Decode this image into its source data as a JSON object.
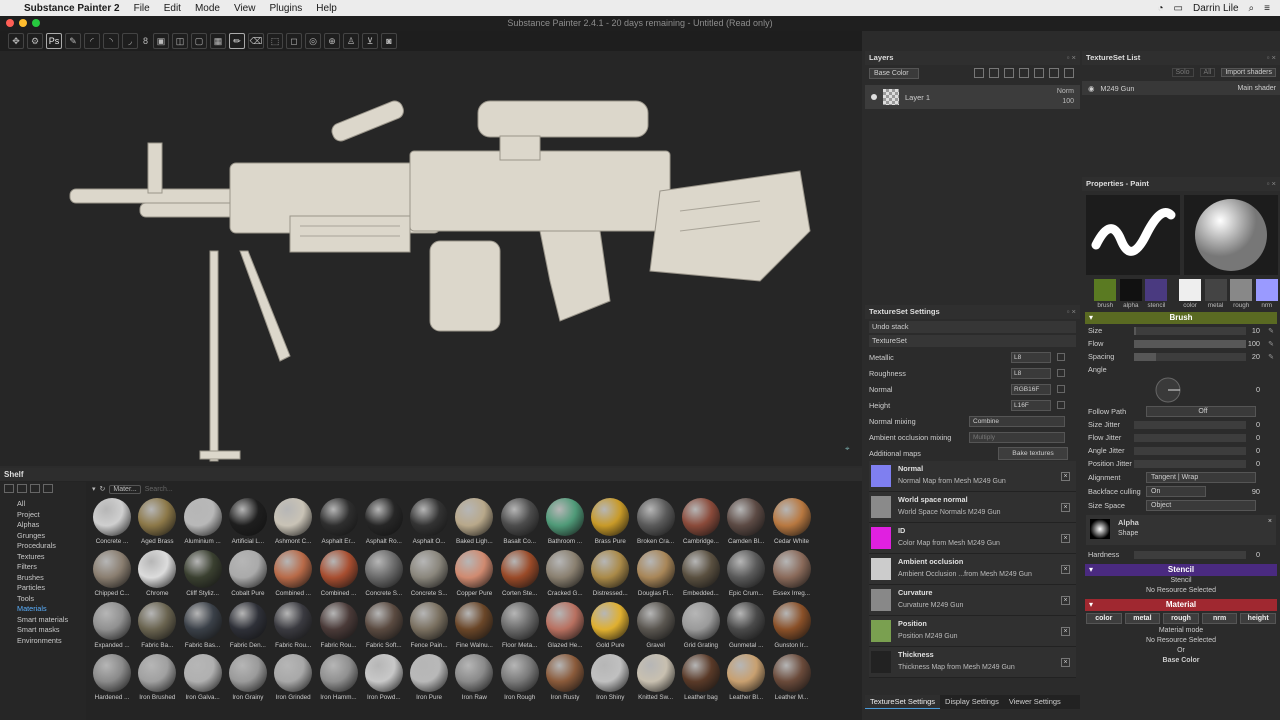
{
  "menubar": {
    "app": "Substance Painter 2",
    "menus": [
      "File",
      "Edit",
      "Mode",
      "View",
      "Plugins",
      "Help"
    ],
    "user": "Darrin Lile"
  },
  "window": {
    "title": "Substance Painter 2.4.1 - 20 days remaining - Untitled (Read only)"
  },
  "toolbar": {
    "brush_size": "8",
    "ps_label": "Ps"
  },
  "shelf": {
    "title": "Shelf",
    "categories": [
      "All",
      "Project",
      "Alphas",
      "Grunges",
      "Procedurals",
      "Textures",
      "Filters",
      "Brushes",
      "Particles",
      "Tools",
      "Materials",
      "Smart materials",
      "Smart masks",
      "Environments"
    ],
    "selected_category": "Materials",
    "filter_chip": "Mater...",
    "search_placeholder": "Search...",
    "items": [
      {
        "label": "Concrete ...",
        "color": "#cfcfcf"
      },
      {
        "label": "Aged Brass",
        "color": "#8c7848"
      },
      {
        "label": "Aluminium ...",
        "color": "#b8b8b8"
      },
      {
        "label": "Artificial L...",
        "color": "#1e1e1e"
      },
      {
        "label": "Ashmont C...",
        "color": "#c9c3b6"
      },
      {
        "label": "Asphalt Er...",
        "color": "#2e2e2e"
      },
      {
        "label": "Asphalt Ro...",
        "color": "#262626"
      },
      {
        "label": "Asphalt O...",
        "color": "#333333"
      },
      {
        "label": "Baked Ligh...",
        "color": "#b8a88a"
      },
      {
        "label": "Basalt Co...",
        "color": "#4c4c4c"
      },
      {
        "label": "Bathroom ...",
        "color": "#4f9a78"
      },
      {
        "label": "Brass Pure",
        "color": "#c89a28"
      },
      {
        "label": "Broken Cra...",
        "color": "#5a5a5a"
      },
      {
        "label": "Cambridge...",
        "color": "#8a4a3a"
      },
      {
        "label": "Camden Bl...",
        "color": "#5c4a44"
      },
      {
        "label": "Cedar White",
        "color": "#b87840"
      },
      {
        "label": "Chipped C...",
        "color": "#8a7e70"
      },
      {
        "label": "Chrome",
        "color": "#dcdcdc"
      },
      {
        "label": "Cliff Styliz...",
        "color": "#3a4030"
      },
      {
        "label": "Cobalt Pure",
        "color": "#aaaaaa"
      },
      {
        "label": "Combined ...",
        "color": "#b86a48"
      },
      {
        "label": "Combined ...",
        "color": "#a84e30"
      },
      {
        "label": "Concrete S...",
        "color": "#6a6a6a"
      },
      {
        "label": "Concrete S...",
        "color": "#8a867c"
      },
      {
        "label": "Copper Pure",
        "color": "#d08a70"
      },
      {
        "label": "Corten Ste...",
        "color": "#9a4a28"
      },
      {
        "label": "Cracked G...",
        "color": "#8a8070"
      },
      {
        "label": "Distressed...",
        "color": "#aa8a48"
      },
      {
        "label": "Douglas Fl...",
        "color": "#a88658"
      },
      {
        "label": "Embedded...",
        "color": "#5a5040"
      },
      {
        "label": "Epic Crum...",
        "color": "#5a5a5a"
      },
      {
        "label": "Essex Irreg...",
        "color": "#8a6a5a"
      },
      {
        "label": "Expanded ...",
        "color": "#909090"
      },
      {
        "label": "Fabric Ba...",
        "color": "#6a6450"
      },
      {
        "label": "Fabric Bas...",
        "color": "#3a4048"
      },
      {
        "label": "Fabric Den...",
        "color": "#2e3038"
      },
      {
        "label": "Fabric Rou...",
        "color": "#3a3a40"
      },
      {
        "label": "Fabric Rou...",
        "color": "#4a3a38"
      },
      {
        "label": "Fabric Soft...",
        "color": "#5a4a40"
      },
      {
        "label": "Fence Pain...",
        "color": "#7a7060"
      },
      {
        "label": "Fine Walnu...",
        "color": "#6a4628"
      },
      {
        "label": "Floor Meta...",
        "color": "#6a6a6a"
      },
      {
        "label": "Glazed He...",
        "color": "#b87060"
      },
      {
        "label": "Gold Pure",
        "color": "#e0b030"
      },
      {
        "label": "Gravel",
        "color": "#5a5650"
      },
      {
        "label": "Grid Grating",
        "color": "#9a9a9a"
      },
      {
        "label": "Gunmetal ...",
        "color": "#4a4a4a"
      },
      {
        "label": "Gunston Ir...",
        "color": "#8a5028"
      },
      {
        "label": "Hardened ...",
        "color": "#8a8a8a"
      },
      {
        "label": "Iron Brushed",
        "color": "#a0a0a0"
      },
      {
        "label": "Iron Galva...",
        "color": "#b0b0b0"
      },
      {
        "label": "Iron Grainy",
        "color": "#9a9a9a"
      },
      {
        "label": "Iron Grinded",
        "color": "#a8a8a8"
      },
      {
        "label": "Iron Hamm...",
        "color": "#909090"
      },
      {
        "label": "Iron Powd...",
        "color": "#c8c8c8"
      },
      {
        "label": "Iron Pure",
        "color": "#b8b8b8"
      },
      {
        "label": "Iron Raw",
        "color": "#8a8a8a"
      },
      {
        "label": "Iron Rough",
        "color": "#7a7a7a"
      },
      {
        "label": "Iron Rusty",
        "color": "#8a5a3a"
      },
      {
        "label": "Iron Shiny",
        "color": "#c0c0c0"
      },
      {
        "label": "Knitted Sw...",
        "color": "#c8c0b0"
      },
      {
        "label": "Leather bag",
        "color": "#5a3a28"
      },
      {
        "label": "Leather Bl...",
        "color": "#c8a070"
      },
      {
        "label": "Leather M...",
        "color": "#6a4a3a"
      }
    ]
  },
  "layers": {
    "title": "Layers",
    "channel": "Base Color",
    "layer": {
      "name": "Layer 1",
      "blend": "Norm",
      "opacity": "100"
    }
  },
  "tss": {
    "title": "TextureSet Settings",
    "undo": "Undo stack",
    "textureset": "TextureSet",
    "maps": [
      {
        "name": "Metallic",
        "fmt": "L8"
      },
      {
        "name": "Roughness",
        "fmt": "L8"
      },
      {
        "name": "Normal",
        "fmt": "RGB16F"
      },
      {
        "name": "Height",
        "fmt": "L16F"
      }
    ],
    "normal_mixing": "Normal mixing",
    "normal_mixing_val": "Combine",
    "ao_mixing": "Ambient occlusion mixing",
    "ao_mixing_val": "Multiply",
    "additional": "Additional maps",
    "bake": "Bake textures",
    "baked": [
      {
        "title": "Normal",
        "desc": "Normal Map from Mesh M249 Gun",
        "color": "#7f7ff0"
      },
      {
        "title": "World space normal",
        "desc": "World Space Normals M249 Gun",
        "color": "#8a8a8a"
      },
      {
        "title": "ID",
        "desc": "Color Map from Mesh M249 Gun",
        "color": "#e020e0"
      },
      {
        "title": "Ambient occlusion",
        "desc": "Ambient Occlusion ...from Mesh M249 Gun",
        "color": "#cccccc"
      },
      {
        "title": "Curvature",
        "desc": "Curvature M249 Gun",
        "color": "#888888"
      },
      {
        "title": "Position",
        "desc": "Position M249 Gun",
        "color": "#7aa050"
      },
      {
        "title": "Thickness",
        "desc": "Thickness Map from Mesh M249 Gun",
        "color": "#222222"
      }
    ],
    "tabs": [
      "TextureSet Settings",
      "Display Settings",
      "Viewer Settings"
    ]
  },
  "tsl": {
    "title": "TextureSet List",
    "solo": "Solo",
    "all": "All",
    "import": "Import shaders",
    "set": "M249 Gun",
    "shader": "Main shader"
  },
  "props": {
    "title": "Properties - Paint",
    "chans": [
      "brush",
      "alpha",
      "stencil"
    ],
    "mats": [
      "color",
      "metal",
      "rough",
      "nrm"
    ],
    "brush": "Brush",
    "size": "Size",
    "size_val": "10",
    "flow": "Flow",
    "flow_val": "100",
    "spacing": "Spacing",
    "spacing_val": "20",
    "angle": "Angle",
    "angle_val": "0",
    "follow": "Follow Path",
    "follow_val": "Off",
    "size_jit": "Size Jitter",
    "flow_jit": "Flow Jitter",
    "angle_jit": "Angle Jitter",
    "pos_jit": "Position Jitter",
    "jit_val": "0",
    "alignment": "Alignment",
    "alignment_val": "Tangent | Wrap",
    "backface": "Backface culling",
    "backface_on": "On",
    "backface_val": "90",
    "space": "Size Space",
    "space_val": "Object",
    "alpha": "Alpha",
    "alpha_shape": "Shape",
    "hardness": "Hardness",
    "hardness_val": "0",
    "stencil": "Stencil",
    "stencil_sub": "Stencil",
    "no_res": "No Resource Selected",
    "material": "Material",
    "mat_btns": [
      "color",
      "metal",
      "rough",
      "nrm",
      "height"
    ],
    "mat_mode": "Material mode",
    "or": "Or",
    "base_color": "Base Color"
  },
  "colors": {
    "brush": "#5a6a22",
    "stencil": "#4a2a80",
    "material": "#a02830",
    "accent": "#4a9ad8"
  }
}
